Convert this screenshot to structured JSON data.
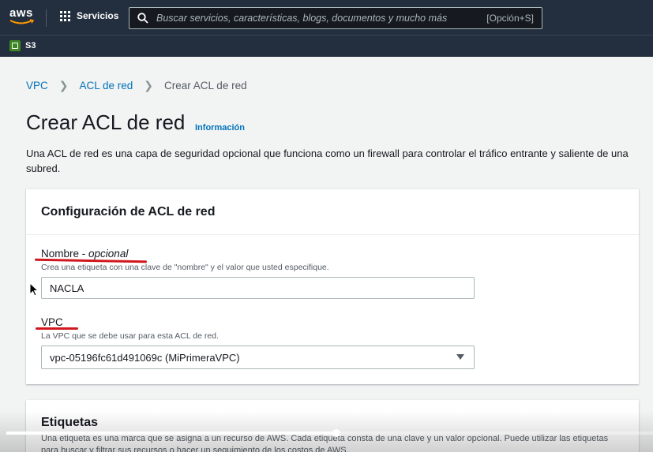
{
  "topnav": {
    "logo_text": "aws",
    "services_label": "Servicios",
    "search_placeholder": "Buscar servicios, características, blogs, documentos y mucho más",
    "search_shortcut": "[Opción+S]"
  },
  "subnav": {
    "service_label": "S3"
  },
  "breadcrumb": {
    "items": [
      "VPC",
      "ACL de red",
      "Crear ACL de red"
    ]
  },
  "page": {
    "title": "Crear ACL de red",
    "info_link": "Información",
    "description": "Una ACL de red es una capa de seguridad opcional que funciona como un firewall para controlar el tráfico entrante y saliente de una subred."
  },
  "config_panel": {
    "title": "Configuración de ACL de red",
    "name_field": {
      "label": "Nombre -",
      "label_optional": "opcional",
      "description": "Crea una etiqueta con una clave de \"nombre\" y el valor que usted especifique.",
      "value": "NACLA"
    },
    "vpc_field": {
      "label": "VPC",
      "description": "La VPC que se debe usar para esta ACL de red.",
      "selected": "vpc-05196fc61d491069c (MiPrimeraVPC)"
    }
  },
  "tags_panel": {
    "title": "Etiquetas",
    "description": "Una etiqueta es una marca que se asigna a un recurso de AWS. Cada etiqueta consta de una clave y un valor opcional. Puede utilizar las etiquetas para buscar y filtrar sus recursos o hacer un seguimiento de los costos de AWS."
  },
  "video": {
    "progress": 0.51
  },
  "colors": {
    "nav_bg": "#232f3e",
    "link": "#0073bb",
    "annotation": "#d1181e",
    "s3_green": "#3f8624"
  }
}
